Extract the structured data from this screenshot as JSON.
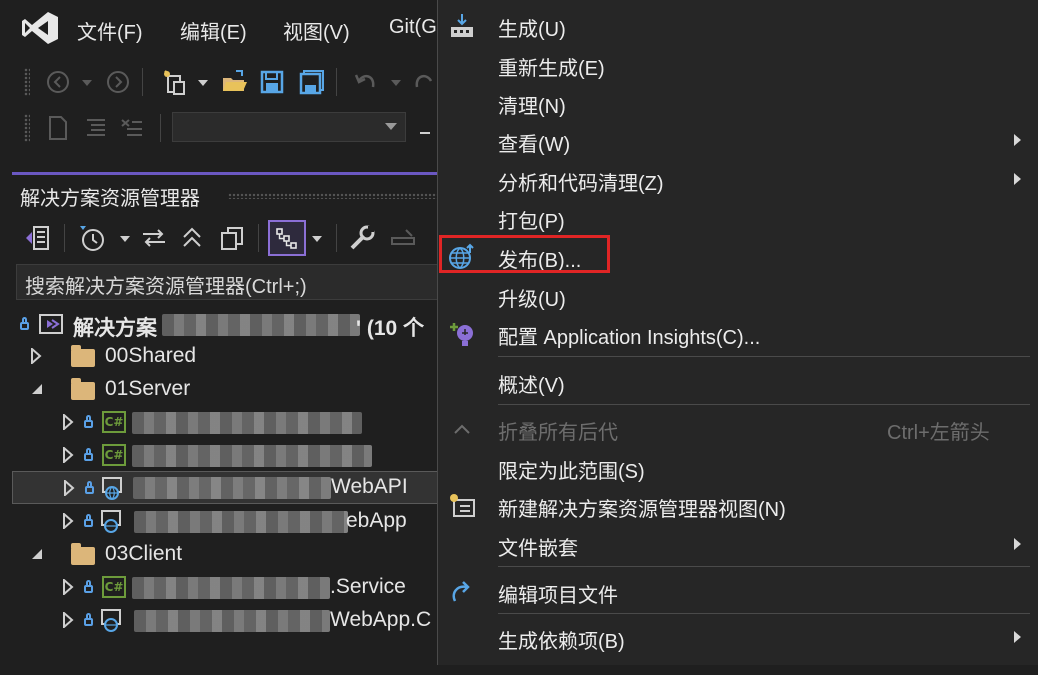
{
  "menubar": {
    "items": [
      "文件(F)",
      "编辑(E)",
      "视图(V)",
      "Git(G"
    ]
  },
  "solution_explorer": {
    "title": "解决方案资源管理器",
    "search_placeholder": "搜索解决方案资源管理器(Ctrl+;)",
    "solution": {
      "prefix": "解决方案",
      "suffix": "' (10 个"
    },
    "tree": [
      {
        "label": "00Shared",
        "type": "folder",
        "expanded": false
      },
      {
        "label": "01Server",
        "type": "folder",
        "expanded": true
      },
      {
        "label": "...",
        "type": "csharp",
        "visible_suffix": ""
      },
      {
        "label": "...",
        "type": "csharp",
        "visible_suffix": ""
      },
      {
        "label": "WebAPI",
        "type": "web",
        "selected": true
      },
      {
        "label": "ebApp",
        "type": "web"
      },
      {
        "label": "03Client",
        "type": "folder",
        "expanded": true
      },
      {
        "label": ".Service",
        "type": "csharp"
      },
      {
        "label": "WebApp.C",
        "type": "web"
      }
    ]
  },
  "context_menu": {
    "items": [
      {
        "label": "生成(U)",
        "icon": "build-icon"
      },
      {
        "label": "重新生成(E)"
      },
      {
        "label": "清理(N)"
      },
      {
        "label": "查看(W)",
        "submenu": true
      },
      {
        "label": "分析和代码清理(Z)",
        "submenu": true
      },
      {
        "label": "打包(P)"
      },
      {
        "label": "发布(B)...",
        "icon": "publish-globe-icon",
        "highlighted": true
      },
      {
        "label": "升级(U)"
      },
      {
        "label": "配置 Application Insights(C)...",
        "icon": "application-insights-icon"
      },
      {
        "label": "概述(V)"
      },
      {
        "label": "折叠所有后代",
        "disabled": true,
        "shortcut": "Ctrl+左箭头",
        "icon": "collapse-chevron-icon"
      },
      {
        "label": "限定为此范围(S)"
      },
      {
        "label": "新建解决方案资源管理器视图(N)",
        "icon": "new-view-icon"
      },
      {
        "label": "文件嵌套",
        "submenu": true
      },
      {
        "label": "编辑项目文件",
        "icon": "edit-project-arrow-icon"
      },
      {
        "label": "生成依赖项(B)",
        "submenu": true
      }
    ]
  },
  "colors": {
    "accent": "#6b58c2",
    "highlight_box": "#e02525",
    "menu_bg": "#262626"
  }
}
